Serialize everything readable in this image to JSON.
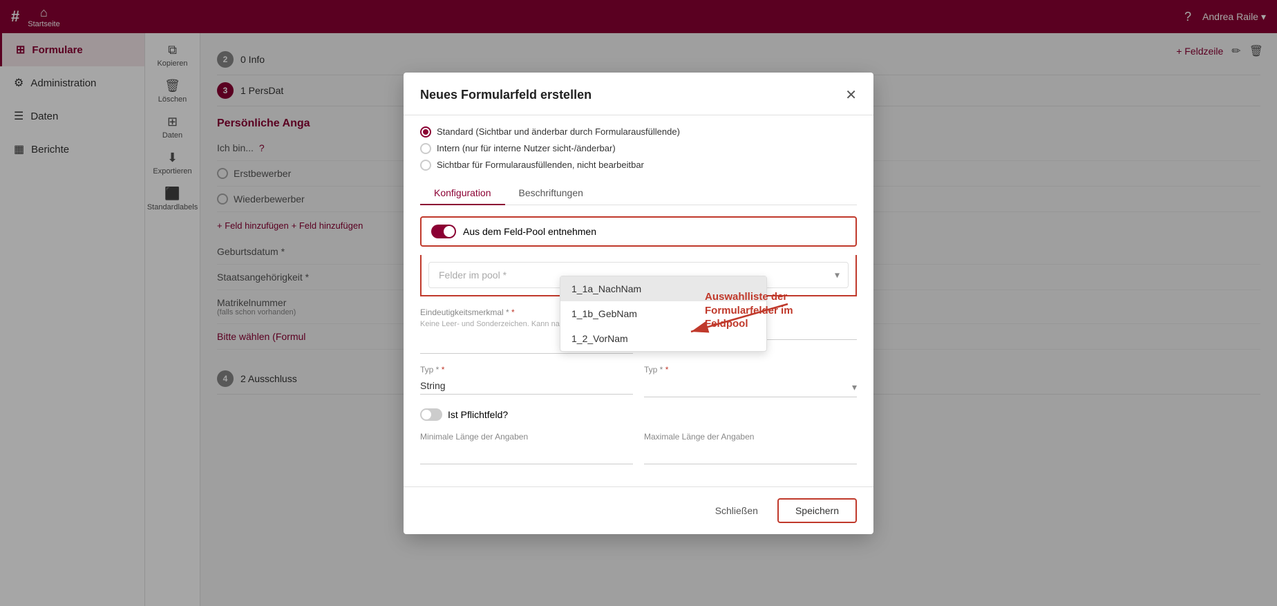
{
  "topnav": {
    "logo": "#",
    "home_label": "Startseite",
    "user_name": "Andrea Raile",
    "user_chevron": "▾",
    "help_icon": "?"
  },
  "sidebar": {
    "items": [
      {
        "id": "formulare",
        "label": "Formulare",
        "icon": "⊞",
        "active": true
      },
      {
        "id": "administration",
        "label": "Administration",
        "icon": "⚙"
      },
      {
        "id": "daten",
        "label": "Daten",
        "icon": "☰"
      },
      {
        "id": "berichte",
        "label": "Berichte",
        "icon": "📊"
      }
    ]
  },
  "toolbar": {
    "buttons": [
      {
        "id": "kopieren",
        "label": "Kopieren",
        "icon": "⧉"
      },
      {
        "id": "loeschen",
        "label": "Löschen",
        "icon": "🗑"
      },
      {
        "id": "daten",
        "label": "Daten",
        "icon": "⊞"
      },
      {
        "id": "exportieren",
        "label": "Exportieren",
        "icon": "⬇"
      },
      {
        "id": "standardlabels",
        "label": "Standardlabels",
        "icon": "⬛"
      }
    ]
  },
  "steps": [
    {
      "num": "2",
      "label": "0 Info",
      "active": false
    },
    {
      "num": "3",
      "label": "1 PersDat",
      "active": true
    },
    {
      "num": "4",
      "label": "2 Ausschluss",
      "active": false
    }
  ],
  "section": {
    "title": "Persönliche Anga",
    "ich_bin_label": "Ich bin...",
    "erstbewerber": "Erstbewerber",
    "wiederbewerber": "Wiederbewerber",
    "add_field_1": "+ Feld hinzufügen",
    "add_field_2": "+ Feld hinzufügen",
    "geburtsdatum": "Geburtsdatum *",
    "staatsangehoerigkeit": "Staatsangehörigkeit *",
    "matrikelnummer": "Matrikelnummer",
    "matrikel_sub": "(falls schon vorhanden)",
    "bitte_waehlen": "Bitte wählen (Formul"
  },
  "top_right": {
    "feldzeile_label": "+ Feldzeile",
    "edit_icon": "✏",
    "delete_icon": "🗑"
  },
  "modal": {
    "title": "Neues Formularfeld erstellen",
    "close_icon": "✕",
    "radio_options": [
      {
        "id": "standard",
        "label": "Standard (Sichtbar und änderbar durch Formularausfüllende)",
        "selected": true
      },
      {
        "id": "intern",
        "label": "Intern (nur für interne Nutzer sicht-/änderbar)",
        "selected": false
      },
      {
        "id": "sichtbar",
        "label": "Sichtbar für Formularausfüllenden, nicht bearbeitbar",
        "selected": false
      }
    ],
    "tabs": [
      {
        "id": "konfiguration",
        "label": "Konfiguration",
        "active": true
      },
      {
        "id": "beschriftungen",
        "label": "Beschriftungen",
        "active": false
      }
    ],
    "toggle_label": "Aus dem Feld-Pool entnehmen",
    "pool_placeholder": "Felder im pool *",
    "pool_items": [
      {
        "id": "1_1a",
        "label": "1_1a_NachNam",
        "highlighted": true
      },
      {
        "id": "1_1b",
        "label": "1_1b_GebNam",
        "highlighted": false
      },
      {
        "id": "1_2",
        "label": "1_2_VorNam",
        "highlighted": false
      }
    ],
    "eindeutigkeit_label": "Eindeutigkeitsmerkmal *",
    "eindeutigkeit_sub": "Keine Leer- und Sonderzeichen. Kann nach dem",
    "typ_label": "Typ *",
    "typ_value": "String",
    "pflichtfeld_label": "Ist Pflichtfeld?",
    "min_laenge_label": "Minimale Länge der Angaben",
    "max_laenge_label": "Maximale Länge der Angaben",
    "footer": {
      "close_label": "Schließen",
      "save_label": "Speichern"
    }
  },
  "annotation": {
    "text": "Auswahlliste der Formularfelder im Feldpool"
  }
}
